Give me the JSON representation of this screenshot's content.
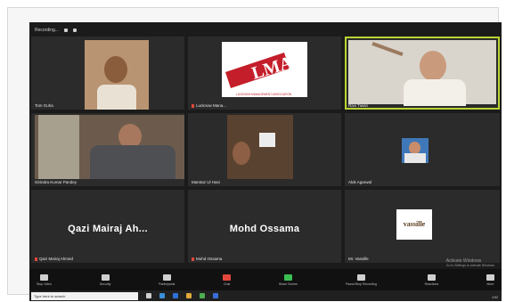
{
  "recording": {
    "label": "Recording..."
  },
  "tiles": [
    {
      "name": "Tom Guha",
      "muted": false
    },
    {
      "name": "Lucknow Mana...",
      "muted": true
    },
    {
      "name": "Ravi Tiwari",
      "muted": false
    },
    {
      "name": "Girindra Kumar Pandey",
      "muted": false
    },
    {
      "name": "Mamtaz Ul Hasi",
      "muted": false
    },
    {
      "name": "Alok Agarwal",
      "muted": false
    },
    {
      "name": "Qazi Mairaj Ahmed",
      "display": "Qazi Mairaj Ah...",
      "muted": true
    },
    {
      "name": "Mohd Ossama",
      "display": "Mohd Ossama",
      "muted": true
    },
    {
      "name": "Mr. Vassille",
      "display": "vassille",
      "muted": false
    }
  ],
  "logo": {
    "text": "LMA",
    "subtitle": "LUCKNOW MANAGEMENT ASSOCIATION",
    "color": "#c41e2a"
  },
  "toolbar": {
    "items": [
      {
        "label": "Stop Video",
        "icon": "video-icon"
      },
      {
        "label": "Security",
        "icon": "shield-icon"
      },
      {
        "label": "Participants",
        "icon": "participants-icon"
      },
      {
        "label": "Chat",
        "icon": "chat-icon"
      },
      {
        "label": "Share Screen",
        "icon": "share-screen-icon"
      },
      {
        "label": "Pause/Stop Recording",
        "icon": "record-icon"
      },
      {
        "label": "Reactions",
        "icon": "reactions-icon"
      },
      {
        "label": "More",
        "icon": "more-icon"
      }
    ]
  },
  "activate": {
    "title": "Activate Windows",
    "subtitle": "Go to Settings to activate Windows"
  },
  "taskbar": {
    "search_placeholder": "Type here to search",
    "clock": "4:52",
    "colors": {
      "accent": "#2d6fd6",
      "active_border": "#b9d532",
      "mute": "#e2473b"
    }
  }
}
